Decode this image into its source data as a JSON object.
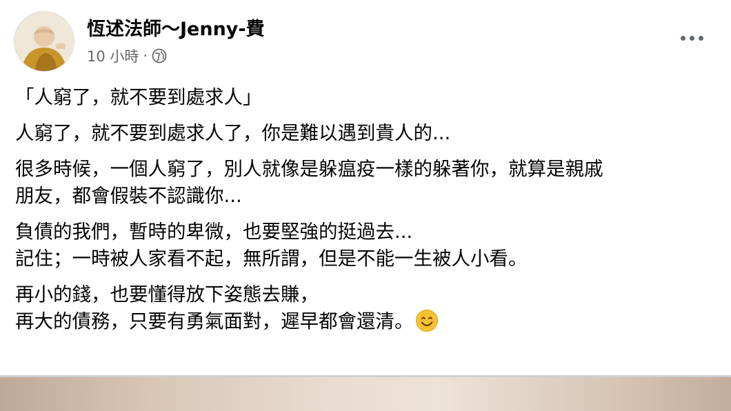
{
  "post": {
    "author": "恆述法師～Jenny-費",
    "time": "10 小時",
    "separator": "·",
    "privacy_icon": "globe-icon",
    "more_icon": "more-options-icon",
    "avatar_icon": "monk-avatar"
  },
  "content": {
    "title": "「人窮了，就不要到處求人」",
    "p1": "人窮了，就不要到處求人了，你是難以遇到貴人的...",
    "p2_l1": "很多時候，一個人窮了，別人就像是躲瘟疫一樣的躲著你，就算是親戚",
    "p2_l2": "朋友，都會假裝不認識你...",
    "p3_l1": "負債的我們，暫時的卑微，也要堅強的挺過去...",
    "p3_l2": "記住；一時被人家看不起，無所謂，但是不能一生被人小看。",
    "p4_l1": "再小的錢，也要懂得放下姿態去賺，",
    "p4_l2": "再大的債務，只要有勇氣面對，遲早都會還清。",
    "emoji": "smiling-face-emoji"
  },
  "colors": {
    "text": "#050505",
    "meta": "#65676b",
    "emoji": "#f6c230"
  }
}
